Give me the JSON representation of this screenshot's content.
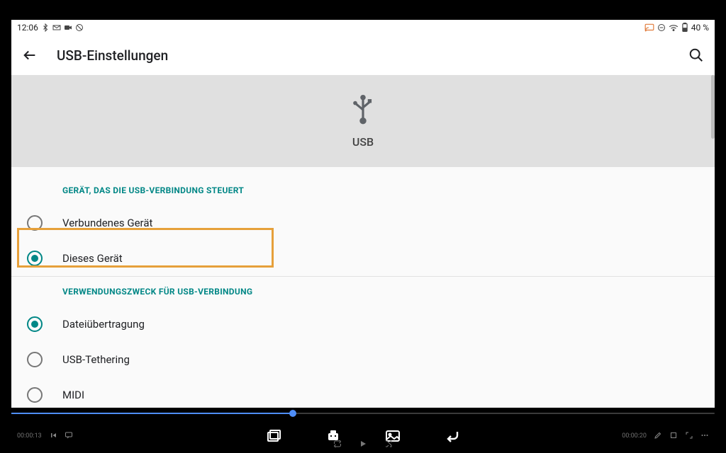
{
  "status": {
    "time": "12:06",
    "battery_text": "40 %"
  },
  "app": {
    "title": "USB-Einstellungen"
  },
  "hero": {
    "label": "USB"
  },
  "sections": {
    "controlling": {
      "header": "GERÄT, DAS DIE USB-VERBINDUNG STEUERT",
      "options": [
        {
          "label": "Verbundenes Gerät"
        },
        {
          "label": "Dieses Gerät"
        }
      ]
    },
    "usage": {
      "header": "VERWENDUNGSZWECK FÜR USB-VERBINDUNG",
      "options": [
        {
          "label": "Dateiübertragung"
        },
        {
          "label": "USB-Tethering"
        },
        {
          "label": "MIDI"
        }
      ]
    }
  },
  "player": {
    "time_left": "00:00:13",
    "time_right": "00:00:20"
  }
}
